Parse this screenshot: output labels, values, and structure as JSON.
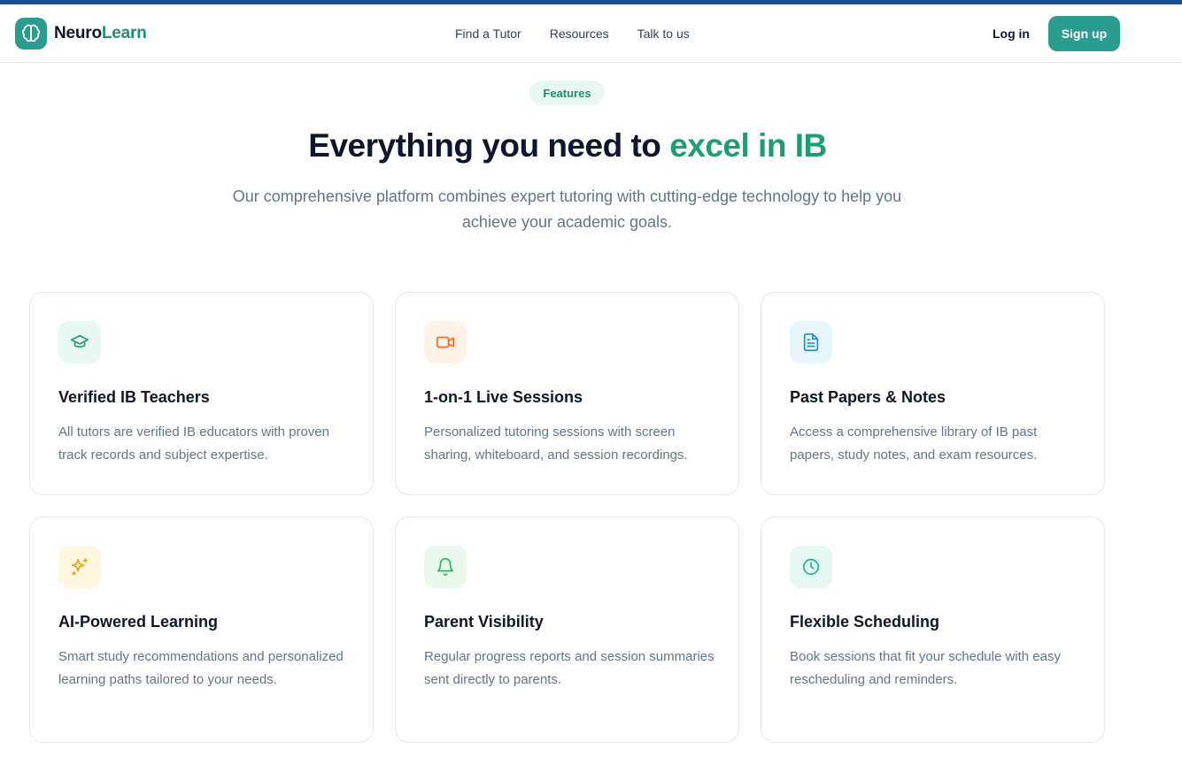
{
  "brand": {
    "name_part1": "Neuro",
    "name_part2": "Learn",
    "logo_icon": "brain-icon"
  },
  "nav": {
    "links": [
      {
        "label": "Find a Tutor"
      },
      {
        "label": "Resources"
      },
      {
        "label": "Talk to us"
      }
    ],
    "login_label": "Log in",
    "signup_label": "Sign up"
  },
  "hero": {
    "badge": "Features",
    "title_plain": "Everything you need to ",
    "title_accent": "excel in IB",
    "subtitle": "Our comprehensive platform combines expert tutoring with cutting-edge technology to help you achieve your academic goals."
  },
  "features": [
    {
      "icon": "graduation-cap-icon",
      "title": "Verified IB Teachers",
      "description": "All tutors are verified IB educators with proven track records and subject expertise."
    },
    {
      "icon": "video-camera-icon",
      "title": "1-on-1 Live Sessions",
      "description": "Personalized tutoring sessions with screen sharing, whiteboard, and session recordings."
    },
    {
      "icon": "document-icon",
      "title": "Past Papers & Notes",
      "description": "Access a comprehensive library of IB past papers, study notes, and exam resources."
    },
    {
      "icon": "sparkles-icon",
      "title": "AI-Powered Learning",
      "description": "Smart study recommendations and personalized learning paths tailored to your needs."
    },
    {
      "icon": "bell-icon",
      "title": "Parent Visibility",
      "description": "Regular progress reports and session summaries sent directly to parents."
    },
    {
      "icon": "clock-icon",
      "title": "Flexible Scheduling",
      "description": "Book sessions that fit your schedule with easy rescheduling and reminders."
    }
  ],
  "colors": {
    "brand_teal": "#2a9d8f",
    "accent_green": "#1f9d72",
    "top_bar": "#1f4e8c"
  }
}
